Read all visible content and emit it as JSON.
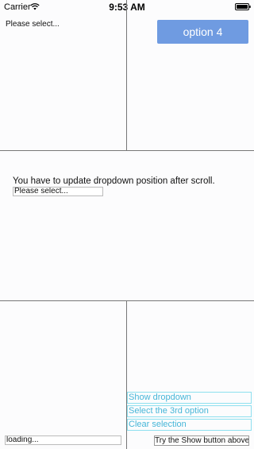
{
  "status_bar": {
    "carrier": "Carrier",
    "time": "9:53 AM",
    "wifi_icon": "wifi-icon",
    "battery_icon": "battery-icon"
  },
  "top_left": {
    "select_text": "Please select..."
  },
  "top_right": {
    "button_label": "option 4",
    "button_color": "#6f9be1"
  },
  "middle": {
    "instruction": "You have to update dropdown position after scroll.",
    "select_text": "Please select..."
  },
  "bottom_left": {
    "loading_text": "loading..."
  },
  "bottom_right": {
    "show_dropdown_label": "Show dropdown",
    "select_third_label": "Select the 3rd option",
    "clear_selection_label": "Clear selection",
    "try_button_label": "Try the Show button above",
    "link_color": "#46b6d8"
  }
}
